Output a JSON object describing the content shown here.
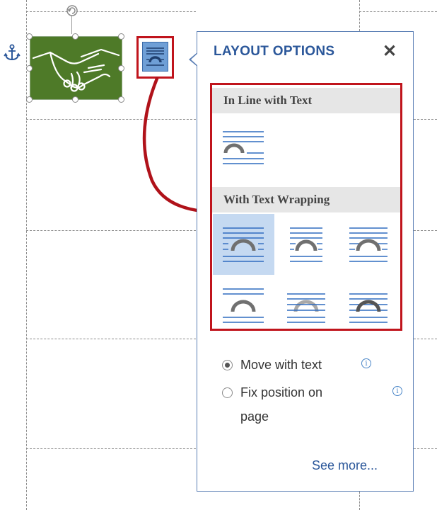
{
  "popup": {
    "title": "LAYOUT OPTIONS",
    "close_glyph": "✕",
    "sections": [
      {
        "label": "In Line with Text"
      },
      {
        "label": "With Text Wrapping"
      }
    ],
    "inline_option": {
      "name": "In Line with Text",
      "icon": "inline-wrap-icon"
    },
    "wrap_options": [
      {
        "name": "Square",
        "icon": "square-wrap-icon",
        "selected": true
      },
      {
        "name": "Tight",
        "icon": "tight-wrap-icon",
        "selected": false
      },
      {
        "name": "Through",
        "icon": "through-wrap-icon",
        "selected": false
      },
      {
        "name": "Top and Bottom",
        "icon": "top-bottom-wrap-icon",
        "selected": false
      },
      {
        "name": "Behind Text",
        "icon": "behind-text-icon",
        "selected": false
      },
      {
        "name": "In Front of Text",
        "icon": "in-front-text-icon",
        "selected": false
      }
    ],
    "move_with_text": {
      "label": "Move with text",
      "checked": true
    },
    "fix_position": {
      "label_line1": "Fix position on",
      "label_line2": "page",
      "checked": false
    },
    "see_more": "See more..."
  },
  "colors": {
    "accent_blue": "#2b579a",
    "highlight_red": "#c0141c",
    "image_green": "#4e7a28",
    "selected_bg": "#c5d9f1"
  }
}
